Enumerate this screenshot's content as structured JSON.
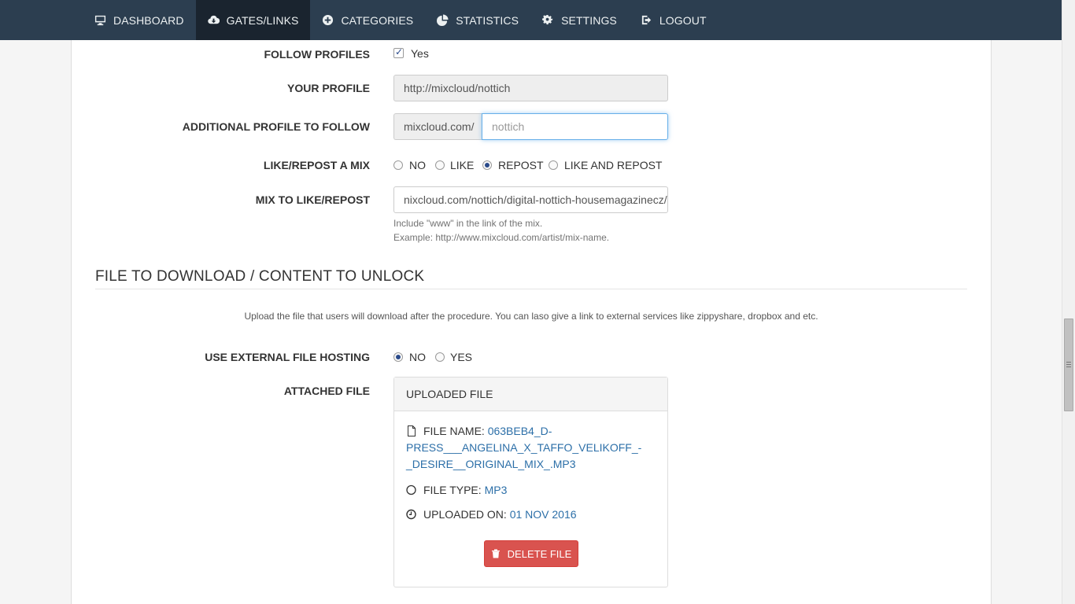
{
  "nav": {
    "items": [
      {
        "label": "DASHBOARD",
        "icon": "monitor-icon",
        "active": false
      },
      {
        "label": "GATES/LINKS",
        "icon": "cloud-download-icon",
        "active": true
      },
      {
        "label": "CATEGORIES",
        "icon": "plus-circle-icon",
        "active": false
      },
      {
        "label": "STATISTICS",
        "icon": "pie-chart-icon",
        "active": false
      },
      {
        "label": "SETTINGS",
        "icon": "gears-icon",
        "active": false
      },
      {
        "label": "LOGOUT",
        "icon": "logout-icon",
        "active": false
      }
    ]
  },
  "form": {
    "follow_profiles": {
      "label": "FOLLOW PROFILES",
      "option": "Yes",
      "checked": true
    },
    "your_profile": {
      "label": "YOUR PROFILE",
      "value": "http://mixcloud/nottich"
    },
    "additional_profile": {
      "label": "ADDITIONAL PROFILE TO FOLLOW",
      "prefix": "mixcloud.com/",
      "placeholder": "nottich"
    },
    "like_repost": {
      "label": "LIKE/REPOST A MIX",
      "options": [
        "NO",
        "LIKE",
        "REPOST",
        "LIKE AND REPOST"
      ],
      "selected": "REPOST"
    },
    "mix_to_like": {
      "label": "MIX TO LIKE/REPOST",
      "value": "nixcloud.com/nottich/digital-nottich-housemagazinecz/",
      "help_line1": "Include \"www\" in the link of the mix.",
      "help_line2": "Example: http://www.mixcloud.com/artist/mix-name."
    }
  },
  "file_section": {
    "title": "FILE TO DOWNLOAD / CONTENT TO UNLOCK",
    "description": "Upload the file that users will download after the procedure. You can laso give a link to external services like zippyshare, dropbox and etc.",
    "external_hosting": {
      "label": "USE EXTERNAL FILE HOSTING",
      "options": [
        "NO",
        "YES"
      ],
      "selected": "NO"
    },
    "attached_label": "ATTACHED FILE",
    "panel": {
      "heading": "UPLOADED FILE",
      "file_name_label": "FILE NAME:",
      "file_name_line1": "063BEB4_D-",
      "file_name_line2": "PRESS___ANGELINA_X_TAFFO_VELIKOFF_-",
      "file_name_line3": "_DESIRE__ORIGINAL_MIX_.MP3",
      "file_type_label": "FILE TYPE:",
      "file_type": "MP3",
      "uploaded_label": "UPLOADED ON:",
      "uploaded_on": "01 NOV 2016",
      "delete_label": "DELETE FILE"
    }
  },
  "colors": {
    "navbar": "#2c3e50",
    "nav_active": "#1a242f",
    "link": "#2c6fa8",
    "danger": "#d9534f"
  }
}
